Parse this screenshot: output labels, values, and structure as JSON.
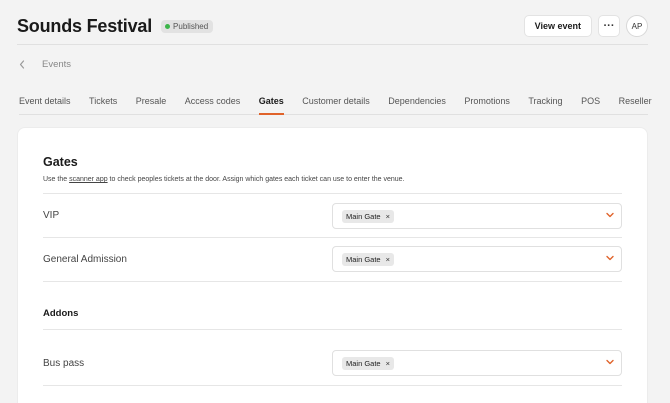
{
  "header": {
    "title": "Sounds Festival",
    "status_badge": "Published",
    "view_event_label": "View event",
    "more_label": "···",
    "avatar_initials": "AP"
  },
  "breadcrumb": {
    "back_label": "Events"
  },
  "tabs": [
    {
      "label": "Event details"
    },
    {
      "label": "Tickets"
    },
    {
      "label": "Presale"
    },
    {
      "label": "Access codes"
    },
    {
      "label": "Gates",
      "active": true
    },
    {
      "label": "Customer details"
    },
    {
      "label": "Dependencies"
    },
    {
      "label": "Promotions"
    },
    {
      "label": "Tracking"
    },
    {
      "label": "POS"
    },
    {
      "label": "Reseller"
    }
  ],
  "gates": {
    "title": "Gates",
    "description_prefix": "Use the ",
    "description_link": "scanner app",
    "description_suffix": " to check peoples tickets at the door. Assign which gates each ticket can use to enter the venue.",
    "rows": [
      {
        "label": "VIP",
        "chip": "Main Gate"
      },
      {
        "label": "General Admission",
        "chip": "Main Gate"
      }
    ],
    "addons_title": "Addons",
    "addon_rows": [
      {
        "label": "Bus pass",
        "chip": "Main Gate"
      }
    ]
  },
  "colors": {
    "accent": "#e0632a",
    "status_dot": "#3cb54a"
  }
}
